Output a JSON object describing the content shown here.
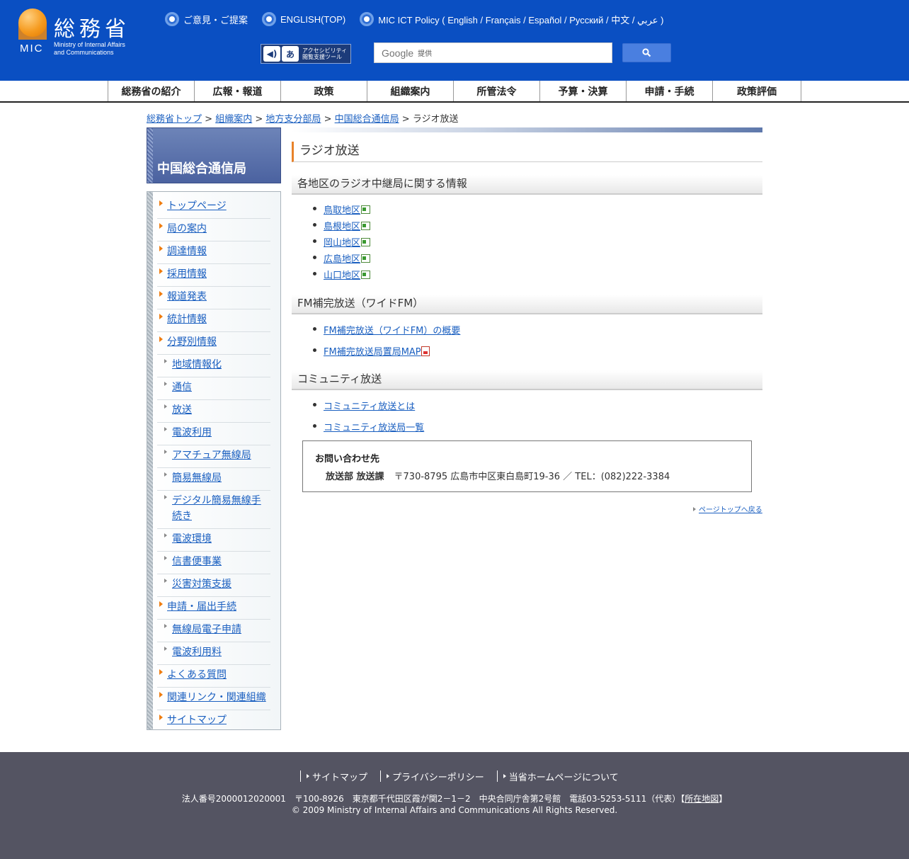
{
  "header": {
    "logo_kanji": "総務省",
    "logo_abbr": "MIC",
    "logo_en_line1": "Ministry of Internal Affairs",
    "logo_en_line2": "and Communications",
    "links": [
      {
        "label": "ご意見・ご提案"
      },
      {
        "label": "ENGLISH(TOP)"
      },
      {
        "label": "MIC ICT Policy ( English / Français / Español / Русский / 中文 / عربي )"
      }
    ],
    "accessibility_line1": "アクセシビリティ",
    "accessibility_line2": "閲覧支援ツール",
    "search_brand": "Google",
    "search_placeholder": "提供"
  },
  "nav": {
    "items": [
      "総務省の紹介",
      "広報・報道",
      "政策",
      "組織案内",
      "所管法令",
      "予算・決算",
      "申請・手続",
      "政策評価"
    ]
  },
  "breadcrumb": {
    "items": [
      "総務省トップ",
      "組織案内",
      "地方支分部局",
      "中国総合通信局"
    ],
    "current": "ラジオ放送",
    "sep": ">"
  },
  "sidebar": {
    "title": "中国総合通信局",
    "items": [
      {
        "label": "トップページ"
      },
      {
        "label": "局の案内"
      },
      {
        "label": "調達情報"
      },
      {
        "label": "採用情報"
      },
      {
        "label": "報道発表"
      },
      {
        "label": "統計情報"
      },
      {
        "label": "分野別情報"
      },
      {
        "label": "地域情報化"
      },
      {
        "label": "通信"
      },
      {
        "label": "放送"
      },
      {
        "label": "電波利用"
      },
      {
        "label": "アマチュア無線局"
      },
      {
        "label": "簡易無線局"
      },
      {
        "label": "デジタル簡易無線手続き"
      },
      {
        "label": "電波環境"
      },
      {
        "label": "信書便事業"
      },
      {
        "label": "災害対策支援"
      },
      {
        "label": "申請・届出手続"
      },
      {
        "label": "無線局電子申請"
      },
      {
        "label": "電波利用料"
      },
      {
        "label": "よくある質問"
      },
      {
        "label": "関連リンク・関連組織"
      },
      {
        "label": "サイトマップ"
      }
    ]
  },
  "main": {
    "title": "ラジオ放送",
    "sections": [
      {
        "heading": "各地区のラジオ中継局に関する情報",
        "links": [
          "鳥取地区",
          "島根地区",
          "岡山地区",
          "広島地区",
          "山口地区"
        ]
      },
      {
        "heading": "FM補完放送（ワイドFM）",
        "links": [
          "FM補完放送（ワイドFM）の概要",
          "FM補完放送局置局MAP"
        ]
      },
      {
        "heading": "コミュニティ放送",
        "links": [
          "コミュニティ放送とは",
          "コミュニティ放送局一覧"
        ]
      }
    ],
    "contact": {
      "title": "お問い合わせ先",
      "dept": "放送部 放送課",
      "detail": "〒730-8795 広島市中区東白島町19-36 ／ TEL：(082)222-3384"
    },
    "pagetop": "ページトップへ戻る"
  },
  "footer": {
    "links": [
      "サイトマップ",
      "プライバシーポリシー",
      "当省ホームページについて"
    ],
    "address": "法人番号2000012020001　〒100-8926　東京都千代田区霞が関2－1－2　中央合同庁舎第2号館　電話03-5253-5111（代表）",
    "map_link": "所在地図",
    "copyright": "© 2009 Ministry of Internal Affairs and Communications All Rights Reserved."
  },
  "colors": {
    "header_bg": "#0a4fc2",
    "link": "#1a5fc0",
    "accent_orange": "#ef7d10",
    "footer_bg": "#545462"
  }
}
